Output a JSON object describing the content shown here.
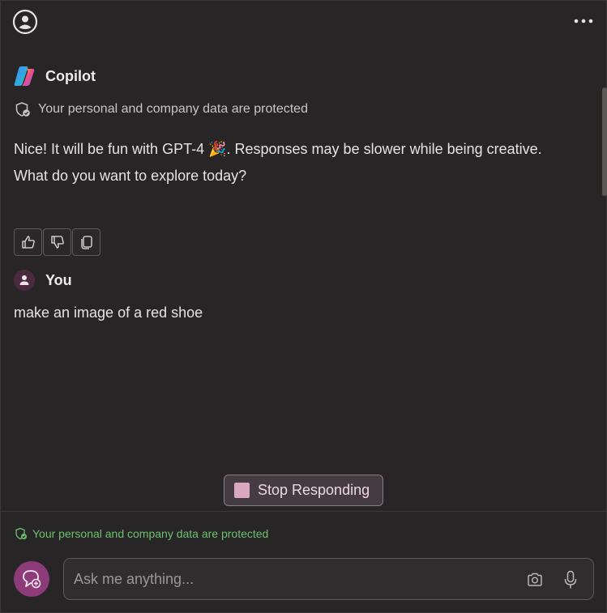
{
  "topbar": {
    "account_icon": "account-circle-icon",
    "more_icon": "more-dots-icon"
  },
  "copilot": {
    "name": "Copilot",
    "protection_notice": "Your personal and company data are protected",
    "message_line1": "Nice! It will be fun with GPT-4 🎉. Responses may be slower while being creative.",
    "message_line2": "What do you want to explore today?",
    "feedback": [
      "thumbs-up-icon",
      "thumbs-down-icon",
      "copy-icon"
    ]
  },
  "user": {
    "name": "You",
    "message": "make an image of a red shoe"
  },
  "stop_button": {
    "label": "Stop Responding"
  },
  "footer": {
    "protection_notice": "Your personal and company data are protected",
    "input_placeholder": "Ask me anything...",
    "input_value": ""
  },
  "colors": {
    "background": "#272525",
    "accent": "#8e3c79",
    "stop_fill": "#d9a7bf",
    "protected_green": "#6fc070"
  }
}
